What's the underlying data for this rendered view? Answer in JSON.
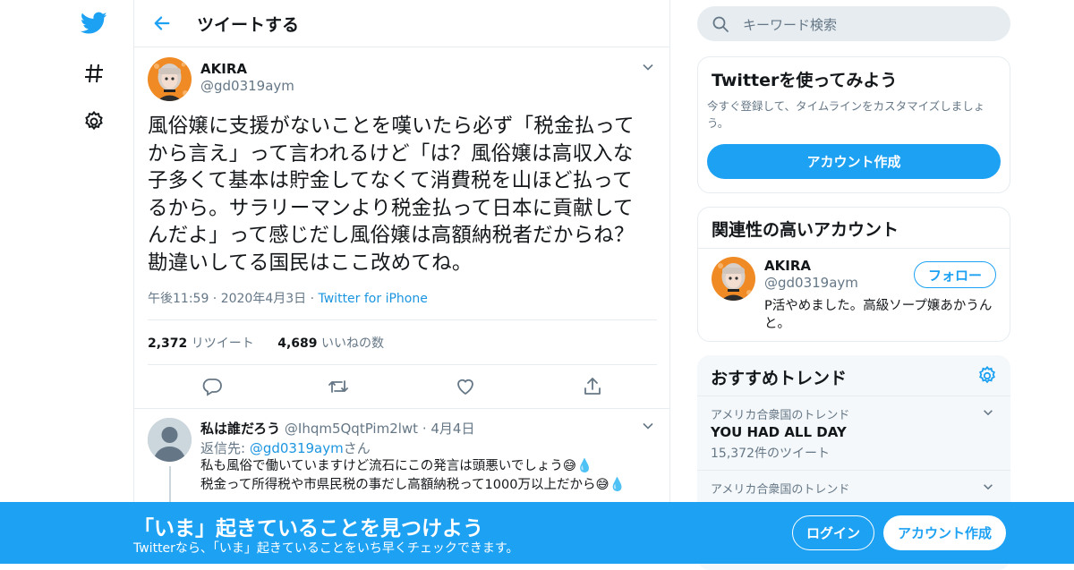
{
  "nav": {
    "icons": [
      "twitter-bird-icon",
      "hashtag-icon",
      "gear-icon"
    ]
  },
  "header": {
    "title": "ツイートする"
  },
  "tweet": {
    "author_name": "AKIRA",
    "author_handle": "@gd0319aym",
    "text_lines": [
      "風俗嬢に支援がないことを嘆いたら必ず「税金払って",
      "から言え」って言われるけど「は？風俗嬢は高収入な",
      "子多くて基本は貯金してなくて消費税を山ほど払って",
      "るから。サラリーマンより税金払って日本に貢献して",
      "んだよ」って感じだし風俗嬢は高額納税者だからね？",
      "勘違いしてる国民はここ改めてね。"
    ],
    "timestamp": "午後11:59 · 2020年4月3日 · ",
    "source": "Twitter for iPhone",
    "retweets_count": "2,372",
    "retweets_label": " リツイート",
    "likes_count": "4,689",
    "likes_label": " いいねの数"
  },
  "reply": {
    "author_name": "私は誰だろう",
    "author_handle": "@Ihqm5QqtPim2lwt",
    "date": " · 4月4日",
    "reply_to_prefix": "返信先: ",
    "reply_to_handle": "@gd0319aym",
    "reply_to_suffix": "さん",
    "line1": "私も風俗で働いていますけど流石にこの発言は頭悪いでしょう😅💧",
    "line2": "税金って所得税や市県民税の事だし高額納税って1000万以上だから😅💧"
  },
  "search": {
    "placeholder": "キーワード検索"
  },
  "signup_card": {
    "title": "Twitterを使ってみよう",
    "description": "今すぐ登録して、タイムラインをカスタマイズしましょう。",
    "button": "アカウント作成"
  },
  "related_card": {
    "title": "関連性の高いアカウント",
    "name": "AKIRA",
    "handle": "@gd0319aym",
    "follow_button": "フォロー",
    "bio": "P活やめました。高級ソープ嬢あかうんと。"
  },
  "trends_card": {
    "title": "おすすめトレンド",
    "items": [
      {
        "context": "アメリカ合衆国のトレンド",
        "name": "YOU HAD ALL DAY",
        "count": "15,372件のツイート"
      },
      {
        "context": "アメリカ合衆国のトレンド",
        "name": "",
        "count": ""
      }
    ]
  },
  "bottom_bar": {
    "headline": "「いま」起きていることを見つけよう",
    "subtext": "Twitterなら、「いま」起きていることをいち早くチェックできます。",
    "login_button": "ログイン",
    "signup_button": "アカウント作成"
  },
  "colors": {
    "accent": "#1da1f2",
    "text": "#14171a",
    "muted": "#657786",
    "border": "#e6ecf0"
  }
}
